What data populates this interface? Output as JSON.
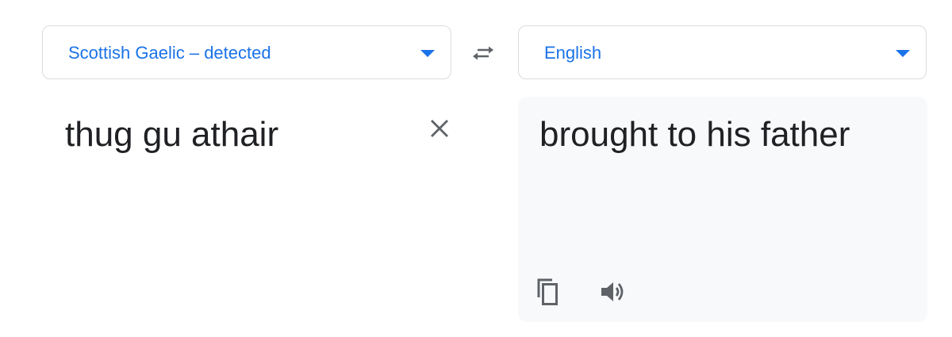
{
  "source_language": {
    "label": "Scottish Gaelic – detected"
  },
  "target_language": {
    "label": "English"
  },
  "source": {
    "text": "thug gu athair"
  },
  "output": {
    "text": "brought to his father"
  },
  "icons": {
    "swap": "swap-arrows-icon",
    "clear": "close-icon",
    "copy": "copy-icon",
    "listen": "speaker-icon",
    "dropdown": "chevron-down-icon"
  },
  "colors": {
    "accent": "#1a73e8",
    "text": "#202124",
    "icon": "#5f6368",
    "border": "#dadce0",
    "panel_bg": "#f8f9fa"
  }
}
